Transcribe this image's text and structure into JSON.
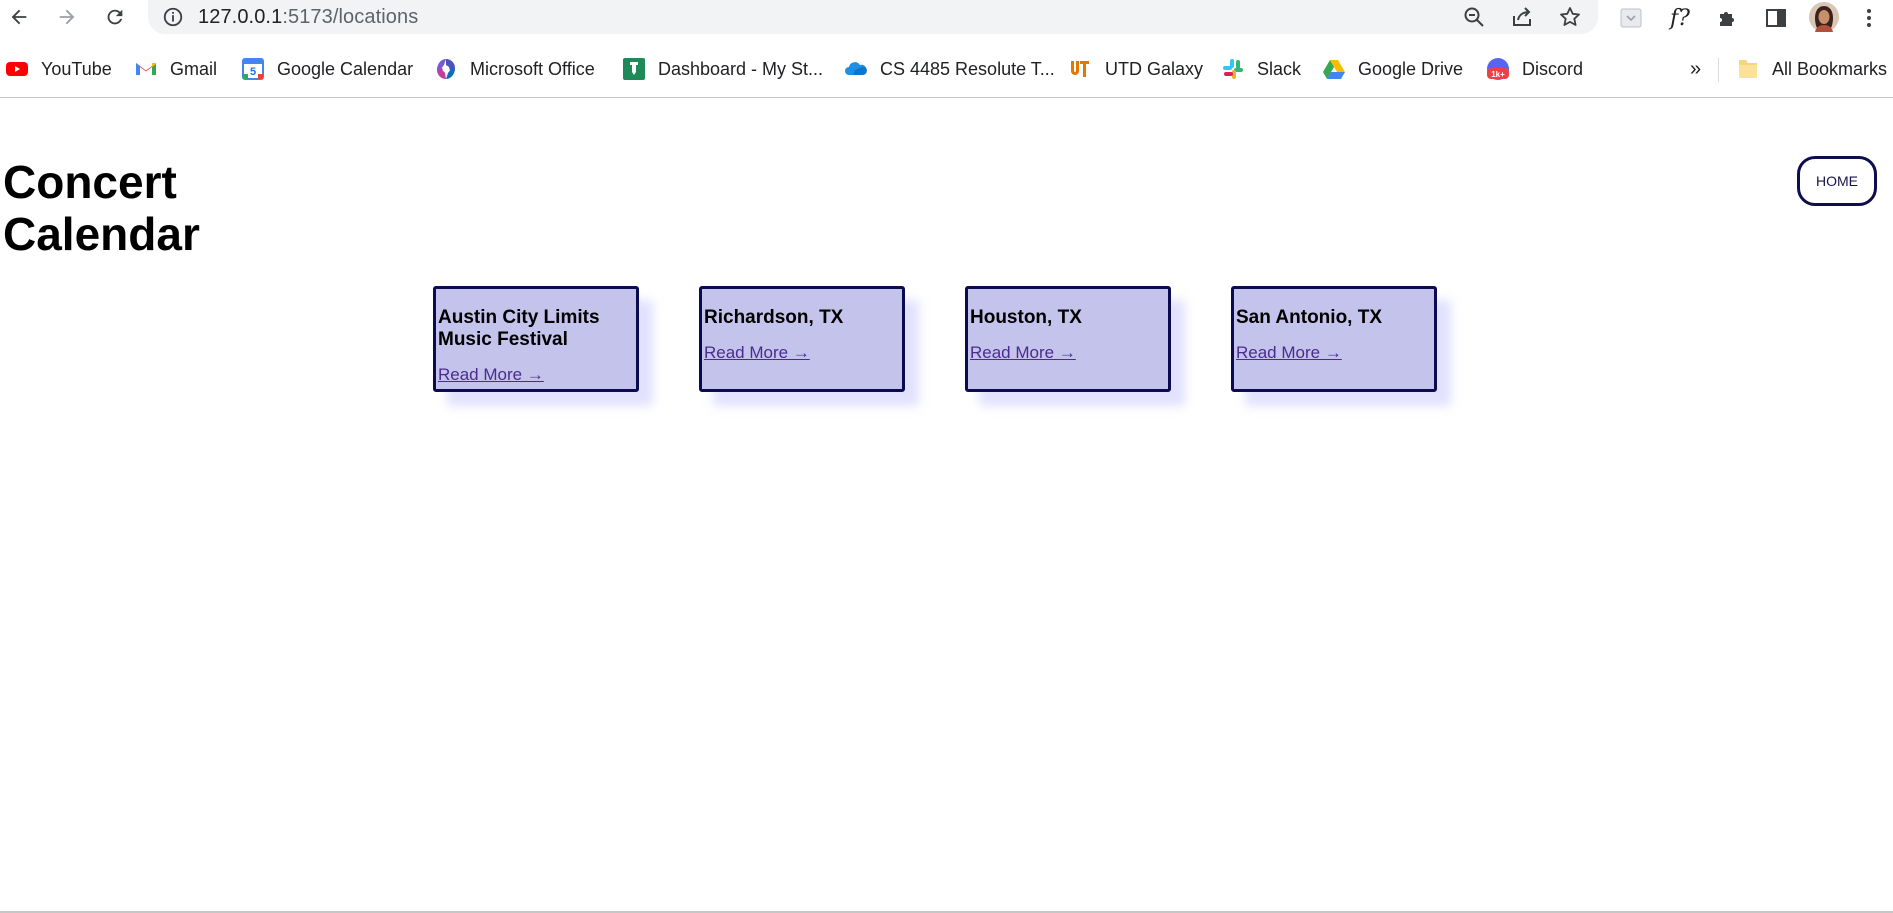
{
  "browser": {
    "url_host": "127.0.0.1",
    "url_path": ":5173/locations",
    "bookmarks": [
      {
        "label": "YouTube",
        "icon": "youtube-icon"
      },
      {
        "label": "Gmail",
        "icon": "gmail-icon"
      },
      {
        "label": "Google Calendar",
        "icon": "google-calendar-icon"
      },
      {
        "label": "Microsoft Office",
        "icon": "microsoft-office-icon"
      },
      {
        "label": "Dashboard - My St...",
        "icon": "dashboard-icon"
      },
      {
        "label": "CS 4485 Resolute T...",
        "icon": "onedrive-icon"
      },
      {
        "label": "UTD Galaxy",
        "icon": "utd-galaxy-icon"
      },
      {
        "label": "Slack",
        "icon": "slack-icon"
      },
      {
        "label": "Google Drive",
        "icon": "google-drive-icon"
      },
      {
        "label": "Discord",
        "icon": "discord-icon"
      }
    ],
    "overflow": "»",
    "all_bookmarks": "All Bookmarks",
    "calendar_day": "5",
    "discord_badge": "1k+",
    "ext_label": "f?"
  },
  "page": {
    "title_line1": "Concert",
    "title_line2": "Calendar",
    "home_label": "HOME",
    "cards": [
      {
        "title": "Austin City Limits Music Festival",
        "link": "Read More →"
      },
      {
        "title": "Richardson, TX",
        "link": "Read More →"
      },
      {
        "title": "Houston, TX",
        "link": "Read More →"
      },
      {
        "title": "San Antonio, TX",
        "link": "Read More →"
      }
    ]
  },
  "colors": {
    "card_bg": "#c3c3ec",
    "card_border": "#0b0b4f",
    "link": "#4b2c8e"
  }
}
